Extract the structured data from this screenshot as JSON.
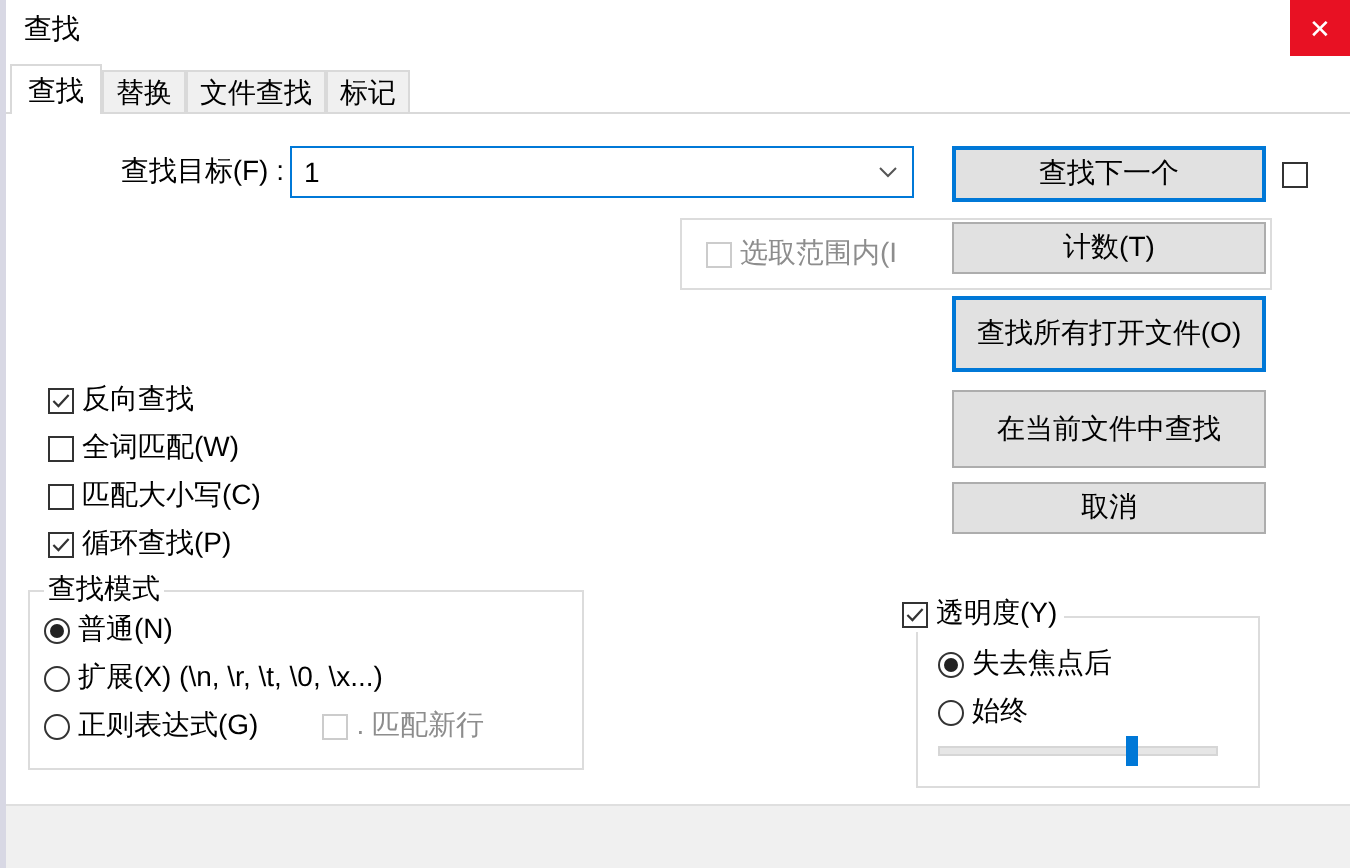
{
  "window": {
    "title": "查找",
    "close": "✕"
  },
  "tabs": [
    {
      "label": "查找",
      "selected": true
    },
    {
      "label": "替换",
      "selected": false
    },
    {
      "label": "文件查找",
      "selected": false
    },
    {
      "label": "标记",
      "selected": false
    }
  ],
  "find": {
    "label": "查找目标(F) :",
    "value": "1"
  },
  "side_checkbox": {
    "checked": false
  },
  "in_selection": {
    "label": "选取范围内(I",
    "checked": false,
    "disabled": true
  },
  "buttons": [
    {
      "label": "查找下一个",
      "focused": true
    },
    {
      "label": "计数(T)",
      "focused": false
    },
    {
      "label": "查找所有打开文件(O)",
      "focused": true
    },
    {
      "label": "在当前文件中查找",
      "focused": false
    },
    {
      "label": "取消",
      "focused": false
    }
  ],
  "options": [
    {
      "label": "反向查找",
      "checked": true
    },
    {
      "label": "全词匹配(W)",
      "checked": false
    },
    {
      "label": "匹配大小写(C)",
      "checked": false
    },
    {
      "label": "循环查找(P)",
      "checked": true
    }
  ],
  "search_mode": {
    "title": "查找模式",
    "options": [
      {
        "label": "普通(N)",
        "selected": true
      },
      {
        "label": "扩展(X) (\\n, \\r, \\t, \\0, \\x...)",
        "selected": false
      },
      {
        "label": "正则表达式(G)",
        "selected": false
      }
    ],
    "dot_newline": {
      "label": ". 匹配新行",
      "checked": false,
      "disabled": true
    }
  },
  "transparency": {
    "label": "透明度(Y)",
    "checked": true,
    "options": [
      {
        "label": "失去焦点后",
        "selected": true
      },
      {
        "label": "始终",
        "selected": false
      }
    ],
    "level": 0.7
  }
}
